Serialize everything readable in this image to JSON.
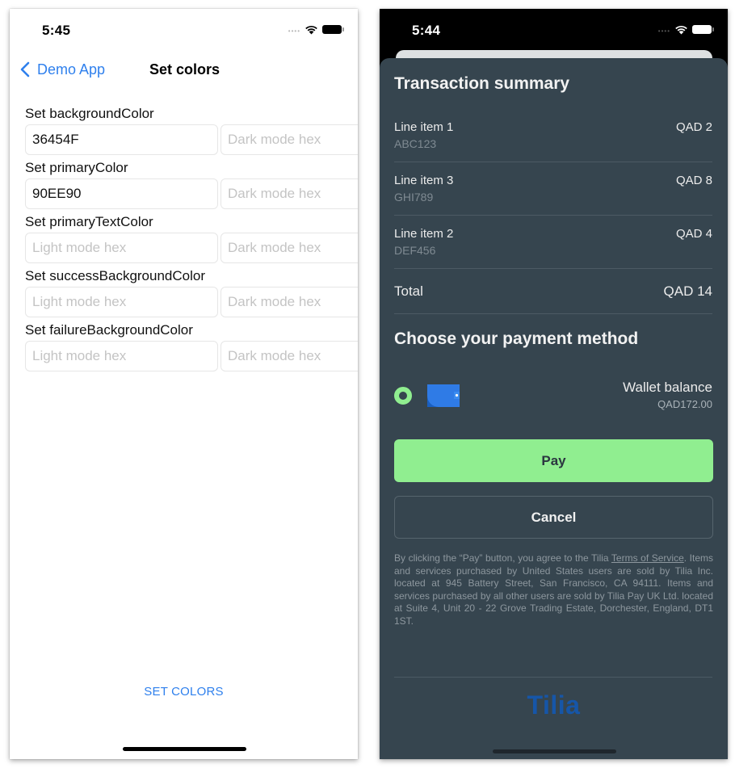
{
  "left_screen": {
    "status_bar": {
      "time": "5:45",
      "signal_icon": "cellular-dots",
      "wifi_icon": "wifi-icon",
      "battery_icon": "battery-icon"
    },
    "nav": {
      "back_label": "Demo App",
      "back_icon": "chevron-left-icon",
      "title": "Set colors"
    },
    "fields": [
      {
        "label": "Set backgroundColor",
        "light_value": "36454F",
        "light_placeholder": "Light mode hex",
        "dark_value": "",
        "dark_placeholder": "Dark mode hex"
      },
      {
        "label": "Set primaryColor",
        "light_value": "90EE90",
        "light_placeholder": "Light mode hex",
        "dark_value": "",
        "dark_placeholder": "Dark mode hex"
      },
      {
        "label": "Set primaryTextColor",
        "light_value": "",
        "light_placeholder": "Light mode hex",
        "dark_value": "",
        "dark_placeholder": "Dark mode hex"
      },
      {
        "label": "Set successBackgroundColor",
        "light_value": "",
        "light_placeholder": "Light mode hex",
        "dark_value": "",
        "dark_placeholder": "Dark mode hex"
      },
      {
        "label": "Set failureBackgroundColor",
        "light_value": "",
        "light_placeholder": "Light mode hex",
        "dark_value": "",
        "dark_placeholder": "Dark mode hex"
      }
    ],
    "set_colors_button": "SET COLORS",
    "accent_color": "#2F80ED"
  },
  "right_screen": {
    "status_bar": {
      "time": "5:44",
      "signal_icon": "cellular-dots",
      "wifi_icon": "wifi-icon",
      "battery_icon": "battery-icon"
    },
    "transaction_summary": {
      "title": "Transaction summary",
      "line_items": [
        {
          "name": "Line item 1",
          "sku": "ABC123",
          "price": "QAD 2"
        },
        {
          "name": "Line item 3",
          "sku": "GHI789",
          "price": "QAD 8"
        },
        {
          "name": "Line item 2",
          "sku": "DEF456",
          "price": "QAD 4"
        }
      ],
      "total_label": "Total",
      "total_value": "QAD 14"
    },
    "payment_method": {
      "title": "Choose your payment method",
      "options": [
        {
          "name": "Wallet balance",
          "balance": "QAD172.00",
          "icon": "wallet-icon",
          "selected": true
        }
      ]
    },
    "pay_button": "Pay",
    "cancel_button": "Cancel",
    "legal": {
      "prefix": "By clicking the “Pay” button, you agree to the Tilia ",
      "terms_link": "Terms of Service",
      "suffix": ". Items and services purchased by United States users are sold by Tilia Inc. located at 945 Battery Street, San Francisco, CA 94111. Items and services purchased by all other users are sold by Tilia Pay UK Ltd. located at Suite 4, Unit 20 - 22 Grove Trading Estate, Dorchester, England, DT1 1ST."
    },
    "logo": "Tilia",
    "colors": {
      "background": "#36454F",
      "primary": "#90EE90",
      "logo": "#1656A8"
    }
  }
}
